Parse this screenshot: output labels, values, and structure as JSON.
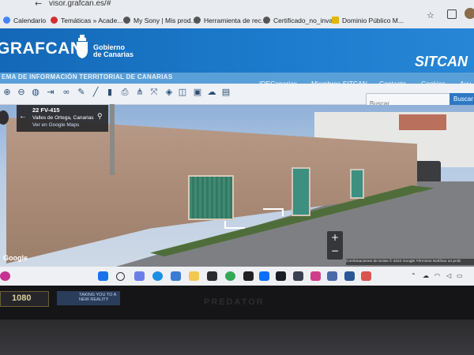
{
  "browser": {
    "url": "visor.grafcan.es/#",
    "bookmarks": [
      {
        "label": "Calendario",
        "color": "#4285f4"
      },
      {
        "label": "Temáticas » Acade...",
        "color": "#d32f2f"
      },
      {
        "label": "My Sony | Mis prod...",
        "color": "#555555"
      },
      {
        "label": "Herramienta de rec...",
        "color": "#555555"
      },
      {
        "label": "Certificado_no_inva...",
        "color": "#555555"
      },
      {
        "label": "Dominio Público M...",
        "color": "#e8b400"
      }
    ]
  },
  "header": {
    "org": "GRAFCAN",
    "gov_line1": "Gobierno",
    "gov_line2": "de Canarias",
    "app": "SITCAN",
    "system_name": "EMA DE INFORMACIÓN TERRITORIAL DE CANARIAS",
    "nav": [
      "IDECanarias",
      "Miembros SITCAN",
      "Contacto",
      "Cookies",
      "Ayu"
    ]
  },
  "search": {
    "placeholder": "Buscar...",
    "button": "Buscar"
  },
  "streetview": {
    "title": "22 FV-415",
    "location": "Valles de Ortega, Canarias",
    "link": "Ver en Google Maps",
    "google": "Google",
    "attribution": "Combinaciones de teclas   © 2024 Google   Términos   Notificar un prob",
    "zoom_in": "+",
    "zoom_out": "−"
  },
  "bezel": {
    "resolution_sticker": "1080",
    "promo_sticker": "TAKING YOU TO A NEW REALITY",
    "brand": "PREDATOR"
  },
  "colors": {
    "header": "#1d7ccd",
    "accent": "#2d78c4"
  }
}
